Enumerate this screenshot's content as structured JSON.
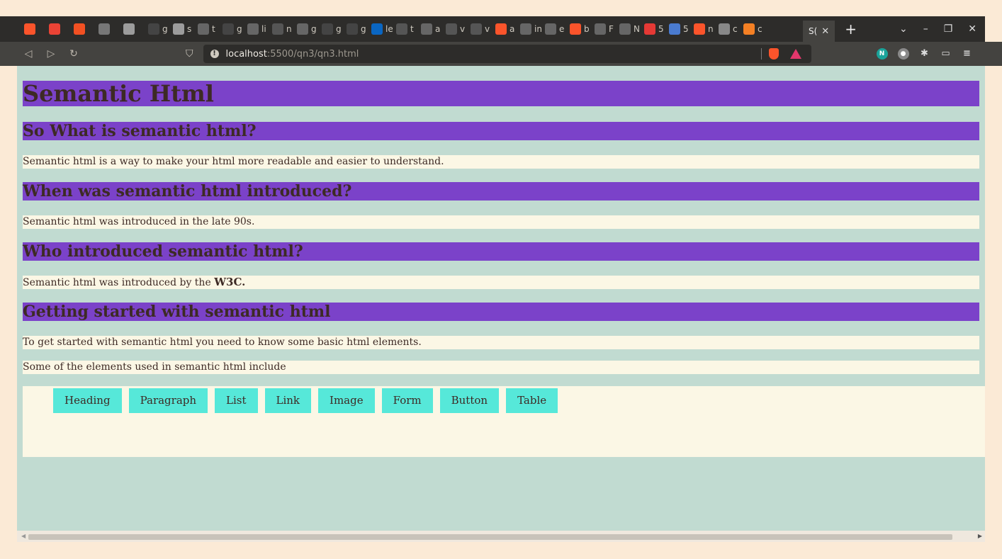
{
  "browser": {
    "tabs": [
      {
        "icon": "brave-icon",
        "color": "#fb542b",
        "label": ""
      },
      {
        "icon": "gmail-icon",
        "color": "#ea4335",
        "label": ""
      },
      {
        "icon": "microsoft-icon",
        "color": "#f25022",
        "label": ""
      },
      {
        "icon": "image-icon",
        "color": "#777777",
        "label": ""
      },
      {
        "icon": "circle-icon",
        "color": "#9c9c9c",
        "label": ""
      },
      {
        "icon": "github-icon",
        "color": "#444444",
        "label": "g"
      },
      {
        "icon": "chrome-icon",
        "color": "#9c9c9c",
        "label": "s"
      },
      {
        "icon": "globe-icon",
        "color": "#666666",
        "label": "t"
      },
      {
        "icon": "github-icon",
        "color": "#444444",
        "label": "g"
      },
      {
        "icon": "globe-icon",
        "color": "#666666",
        "label": "li"
      },
      {
        "icon": "terminal-icon",
        "color": "#555555",
        "label": "n"
      },
      {
        "icon": "magnet-icon",
        "color": "#666666",
        "label": "g"
      },
      {
        "icon": "github-icon",
        "color": "#444444",
        "label": "g"
      },
      {
        "icon": "github-icon",
        "color": "#444444",
        "label": "g"
      },
      {
        "icon": "linkedin-icon",
        "color": "#0a66c2",
        "label": "le"
      },
      {
        "icon": "bold-icon",
        "color": "#555555",
        "label": "t"
      },
      {
        "icon": "globe-icon",
        "color": "#666666",
        "label": "a"
      },
      {
        "icon": "terminal-icon",
        "color": "#555555",
        "label": "v"
      },
      {
        "icon": "terminal-icon",
        "color": "#555555",
        "label": "v"
      },
      {
        "icon": "brave-icon",
        "color": "#fb542b",
        "label": "a"
      },
      {
        "icon": "stack-icon",
        "color": "#666666",
        "label": "in"
      },
      {
        "icon": "m-icon",
        "color": "#666666",
        "label": "e"
      },
      {
        "icon": "brave-icon",
        "color": "#fb542b",
        "label": "b"
      },
      {
        "icon": "dash-icon",
        "color": "#666666",
        "label": "F"
      },
      {
        "icon": "globe-icon",
        "color": "#666666",
        "label": "N"
      },
      {
        "icon": "notification-icon",
        "color": "#e53935",
        "label": "5"
      },
      {
        "icon": "mail-icon",
        "color": "#4a7bd0",
        "label": "5"
      },
      {
        "icon": "brave-icon",
        "color": "#fb542b",
        "label": "n"
      },
      {
        "icon": "doc-icon",
        "color": "#888888",
        "label": "c"
      },
      {
        "icon": "stackoverflow-icon",
        "color": "#f48024",
        "label": "c"
      }
    ],
    "active_tab": {
      "label": "S("
    },
    "url_host": "localhost",
    "url_path": ":5500/qn3/qn3.html"
  },
  "page": {
    "title": "Semantic Html",
    "sections": [
      {
        "heading": "So What is semantic html?",
        "text": "Semantic html is a way to make your html more readable and easier to understand."
      },
      {
        "heading": "When was semantic html introduced?",
        "text": "Semantic html was introduced in the late 90s."
      },
      {
        "heading": "Who introduced semantic html?",
        "text": "Semantic html was introduced by the ",
        "bold": "W3C."
      }
    ],
    "getting_started": {
      "heading": "Getting started with semantic html",
      "text1": "To get started with semantic html you need to know some basic html elements.",
      "text2": "Some of the elements used in semantic html include"
    },
    "elements": [
      "Heading",
      "Paragraph",
      "List",
      "Link",
      "Image",
      "Form",
      "Button",
      "Table"
    ]
  }
}
